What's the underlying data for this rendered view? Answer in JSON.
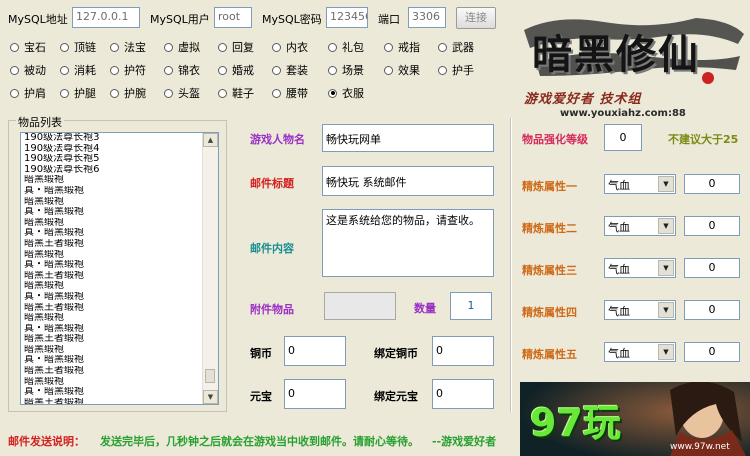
{
  "connection": {
    "host_label": "MySQL地址",
    "host_value": "127.0.0.1",
    "user_label": "MySQL用户",
    "user_value": "root",
    "password_label": "MySQL密码",
    "password_value": "123456",
    "port_label": "端口",
    "port_value": "3306",
    "connect_button": "连接"
  },
  "categories": [
    {
      "label": "宝石",
      "selected": false
    },
    {
      "label": "顶链",
      "selected": false
    },
    {
      "label": "法宝",
      "selected": false
    },
    {
      "label": "虚拟",
      "selected": false
    },
    {
      "label": "回复",
      "selected": false
    },
    {
      "label": "内衣",
      "selected": false
    },
    {
      "label": "礼包",
      "selected": false
    },
    {
      "label": "戒指",
      "selected": false
    },
    {
      "label": "武器",
      "selected": false
    },
    {
      "label": "被动",
      "selected": false
    },
    {
      "label": "消耗",
      "selected": false
    },
    {
      "label": "护符",
      "selected": false
    },
    {
      "label": "锦衣",
      "selected": false
    },
    {
      "label": "婚戒",
      "selected": false
    },
    {
      "label": "套装",
      "selected": false
    },
    {
      "label": "场景",
      "selected": false
    },
    {
      "label": "效果",
      "selected": false
    },
    {
      "label": "护手",
      "selected": false
    },
    {
      "label": "护肩",
      "selected": false
    },
    {
      "label": "护腿",
      "selected": false
    },
    {
      "label": "护腕",
      "selected": false
    },
    {
      "label": "头盔",
      "selected": false
    },
    {
      "label": "鞋子",
      "selected": false
    },
    {
      "label": "腰带",
      "selected": false
    },
    {
      "label": "衣服",
      "selected": true
    }
  ],
  "item_list": {
    "title": "物品列表",
    "items": [
      "190级法尊长袍3",
      "190级法尊长袍4",
      "190级法尊长袍5",
      "190级法尊长袍6",
      "暗黑缎袍",
      "真・暗黑缎袍",
      "暗黑缎袍",
      "真・暗黑缎袍",
      "暗黑缎袍",
      "真・暗黑缎袍",
      "暗黑王者缎袍",
      "暗黑缎袍",
      "真・暗黑缎袍",
      "暗黑王者缎袍",
      "暗黑缎袍",
      "真・暗黑缎袍",
      "暗黑王者缎袍",
      "暗黑缎袍",
      "真・暗黑缎袍",
      "暗黑王者缎袍",
      "暗黑缎袍",
      "真・暗黑缎袍",
      "暗黑王者缎袍",
      "暗黑缎袍",
      "真・暗黑缎袍",
      "暗黑王者缎袍"
    ]
  },
  "mail": {
    "player_label": "游戏人物名",
    "player_value": "畅快玩网单",
    "title_label": "邮件标题",
    "title_value": "畅快玩  系统邮件",
    "content_label": "邮件内容",
    "content_value": "这是系统给您的物品，请查收。",
    "attach_label": "附件物品",
    "attach_value": "",
    "qty_label": "数量",
    "qty_value": "1",
    "copper_label": "铜币",
    "copper_value": "0",
    "bound_copper_label": "绑定铜币",
    "bound_copper_value": "0",
    "yuanbao_label": "元宝",
    "yuanbao_value": "0",
    "bound_yuanbao_label": "绑定元宝",
    "bound_yuanbao_value": "0"
  },
  "enhance": {
    "level_label": "物品强化等级",
    "level_value": "0",
    "hint": "不建议大于25",
    "refine": [
      {
        "label": "精炼属性一",
        "attr": "气血",
        "value": "0"
      },
      {
        "label": "精炼属性二",
        "attr": "气血",
        "value": "0"
      },
      {
        "label": "精炼属性三",
        "attr": "气血",
        "value": "0"
      },
      {
        "label": "精炼属性四",
        "attr": "气血",
        "value": "0"
      },
      {
        "label": "精炼属性五",
        "attr": "气血",
        "value": "0"
      }
    ]
  },
  "footer": {
    "label": "邮件发送说明：",
    "text": "发送完毕后，几秒钟之后就会在游戏当中收到邮件。请耐心等待。",
    "sign": "--游戏爱好者"
  },
  "logo": {
    "title": "暗黑修仙",
    "slogan": "游戏爱好者 技术组",
    "url": "www.youxiahz.com:88"
  },
  "ad": {
    "brand": "97玩",
    "url": "www.97w.net"
  },
  "colors": {
    "window_bg": "#ece9d8",
    "field_border": "#7f9db9",
    "label_purple": "#9b30c6",
    "label_red": "#d42020",
    "label_teal": "#188f93",
    "label_orange": "#cf6a18",
    "hint_olive": "#7c8a16",
    "footer_green": "#27a030"
  }
}
